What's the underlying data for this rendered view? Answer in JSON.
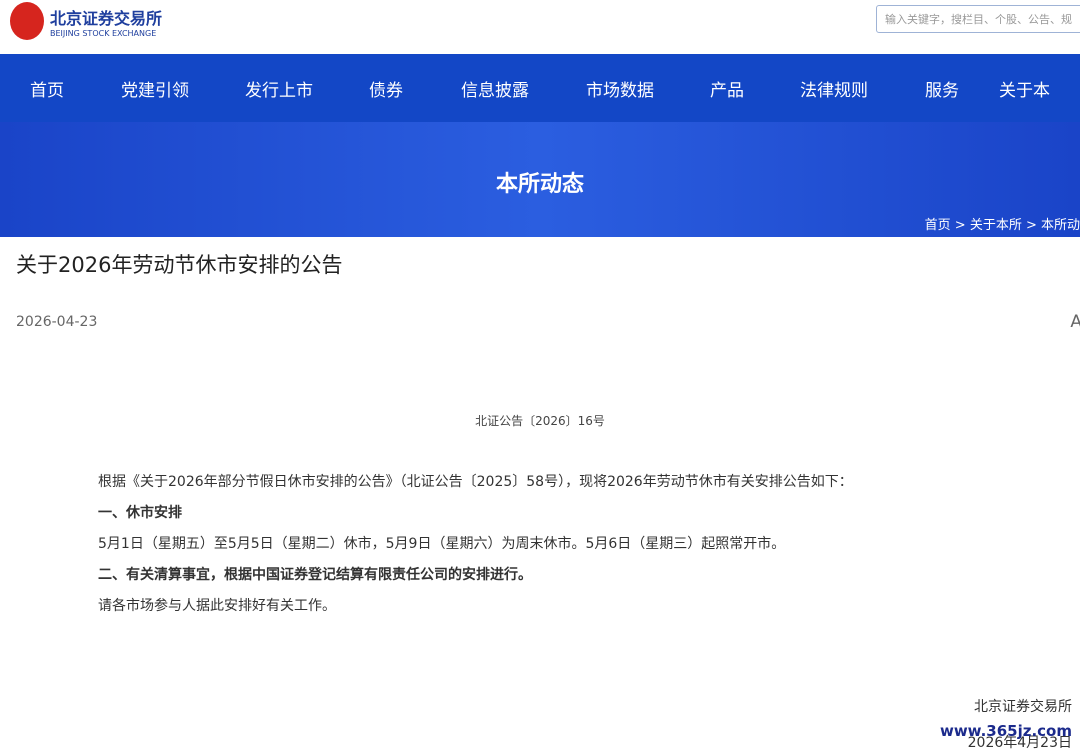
{
  "header": {
    "logo_cn": "北京证券交易所",
    "logo_en": "BEIJING STOCK EXCHANGE",
    "search_placeholder": "输入关键字，搜栏目、个股、公告、规"
  },
  "nav": [
    "首页",
    "党建引领",
    "发行上市",
    "债券",
    "信息披露",
    "市场数据",
    "产品",
    "法律规则",
    "服务",
    "关于本"
  ],
  "banner": {
    "title": "本所动态",
    "crumbs": "首页 > 关于本所 > 本所动"
  },
  "article": {
    "title": "关于2026年劳动节休市安排的公告",
    "date": "2026-04-23",
    "font_btn": "A",
    "doc_no": "北证公告〔2026〕16号",
    "p1": "根据《关于2026年部分节假日休市安排的公告》（北证公告〔2025〕58号），现将2026年劳动节休市有关安排公告如下：",
    "h1": "一、休市安排",
    "p2": "5月1日（星期五）至5月5日（星期二）休市，5月9日（星期六）为周末休市。5月6日（星期三）起照常开市。",
    "h2": "二、有关清算事宜，根据中国证券登记结算有限责任公司的安排进行。",
    "p3": "请各市场参与人据此安排好有关工作。",
    "signer": "北京证券交易所",
    "sign_date": "2026年4月23日"
  },
  "watermark": "www.365jz.com"
}
